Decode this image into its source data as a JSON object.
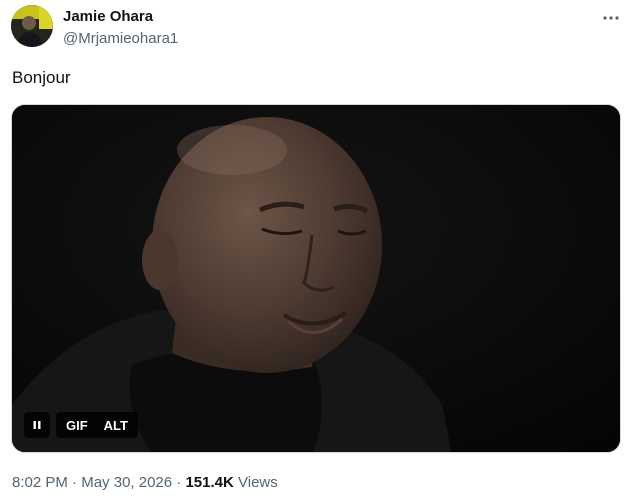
{
  "author": {
    "name": "Jamie Ohara",
    "handle": "@Mrjamieohara1"
  },
  "tweet": {
    "text": "Bonjour"
  },
  "media": {
    "gif_label": "GIF",
    "alt_label": "ALT"
  },
  "meta": {
    "time": "8:02 PM",
    "separator": "·",
    "date": "May 30, 2026",
    "views_count": "151.4K",
    "views_label": "Views"
  }
}
